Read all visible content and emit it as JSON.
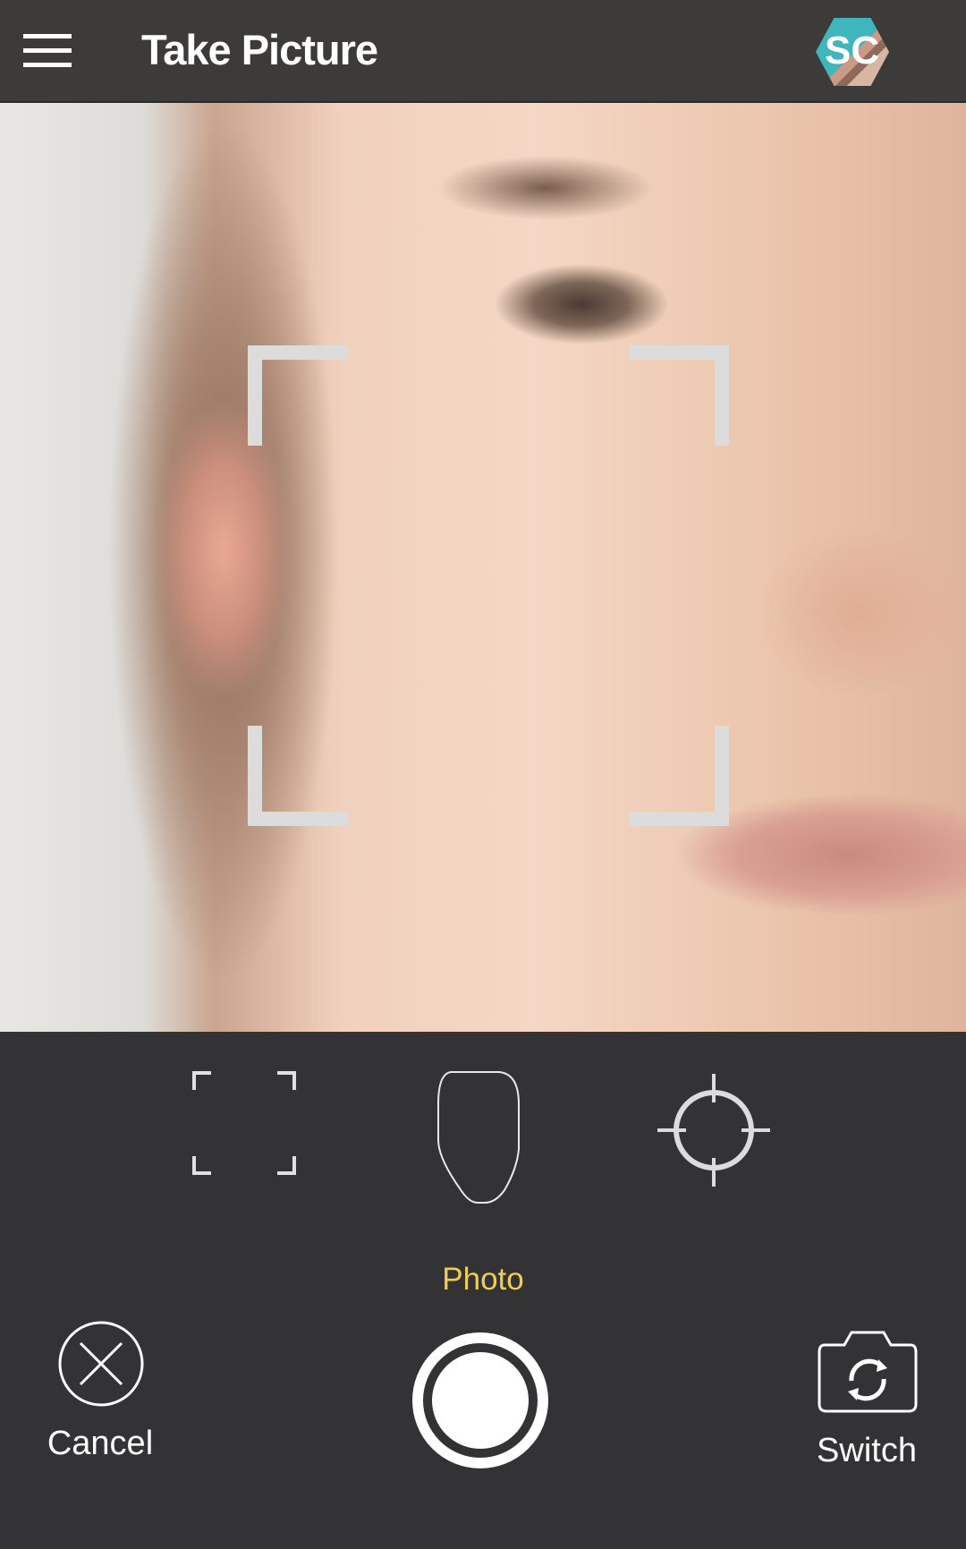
{
  "header": {
    "title": "Take Picture",
    "menu_icon": "hamburger-menu-icon",
    "logo_text": "SC"
  },
  "camera": {
    "preview": "face-camera-preview",
    "frame_color": "#dcdcdc"
  },
  "modes": [
    {
      "icon": "frame-corners-icon"
    },
    {
      "icon": "face-outline-icon"
    },
    {
      "icon": "crosshair-icon"
    }
  ],
  "mode_label": "Photo",
  "mode_label_color": "#f0cd55",
  "actions": {
    "cancel_label": "Cancel",
    "switch_label": "Switch",
    "shutter_icon": "shutter-button-icon"
  }
}
